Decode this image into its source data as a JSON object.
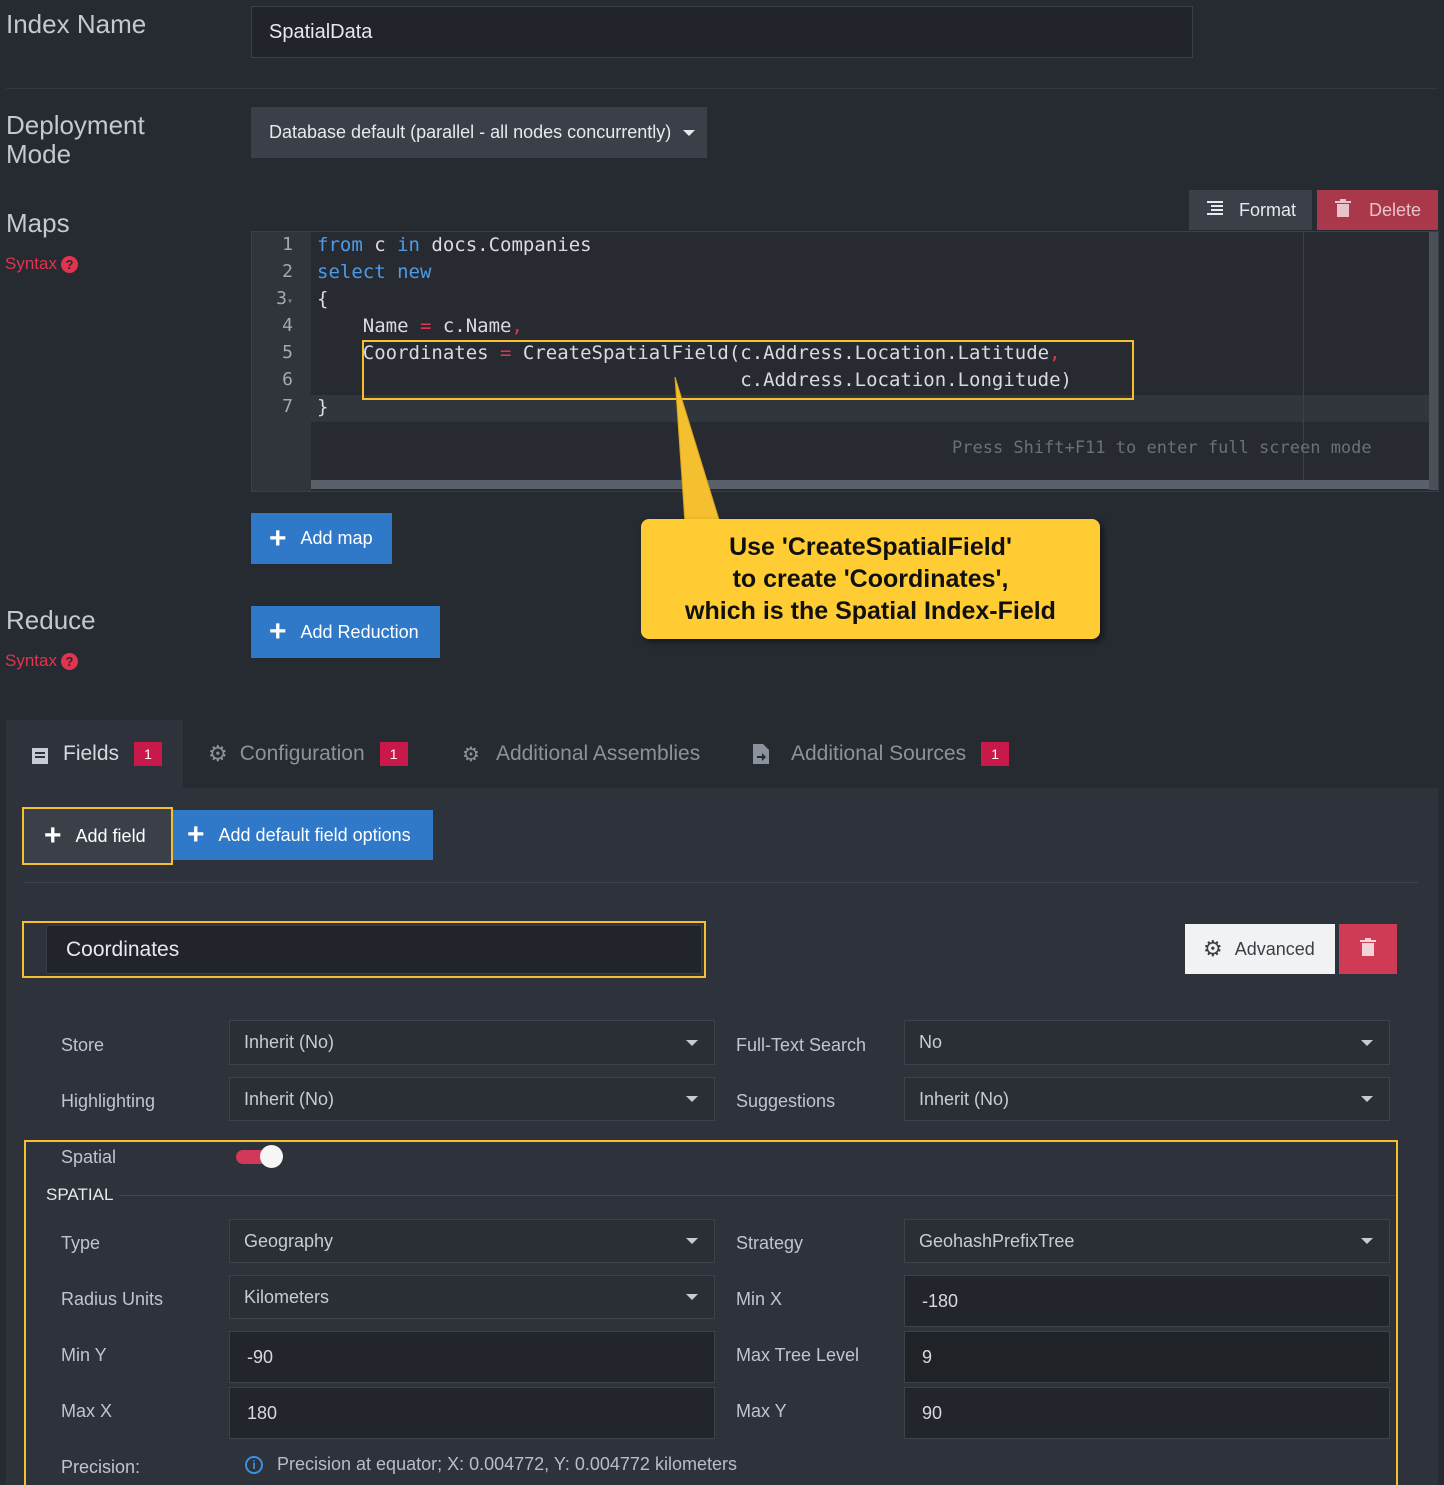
{
  "index_name": {
    "label": "Index Name",
    "value": "SpatialData"
  },
  "deployment": {
    "label": "Deployment Mode",
    "value": "Database default (parallel - all nodes concurrently)"
  },
  "maps": {
    "label": "Maps",
    "syntax_label": "Syntax",
    "format_label": "Format",
    "delete_label": "Delete",
    "add_map_label": "Add map",
    "code_lines": [
      {
        "num": "1",
        "text": "from c in docs.Companies"
      },
      {
        "num": "2",
        "text": "select new"
      },
      {
        "num": "3",
        "text": "{"
      },
      {
        "num": "4",
        "text": "    Name = c.Name,"
      },
      {
        "num": "5",
        "text": "    Coordinates = CreateSpatialField(c.Address.Location.Latitude,"
      },
      {
        "num": "6",
        "text": "                                     c.Address.Location.Longitude)"
      },
      {
        "num": "7",
        "text": "}"
      }
    ],
    "fullscreen_hint": "Press Shift+F11 to enter full screen mode"
  },
  "callout": {
    "line1": "Use 'CreateSpatialField'",
    "line2": "to create 'Coordinates',",
    "line3": "which is the Spatial Index-Field"
  },
  "reduce": {
    "label": "Reduce",
    "syntax_label": "Syntax",
    "add_reduction_label": "Add Reduction"
  },
  "tabs": [
    {
      "label": "Fields",
      "badge": "1"
    },
    {
      "label": "Configuration",
      "badge": "1"
    },
    {
      "label": "Additional Assemblies"
    },
    {
      "label": "Additional Sources",
      "badge": "1"
    }
  ],
  "fields_panel": {
    "add_field_label": "Add field",
    "add_default_label": "Add default field options",
    "field_name": "Coordinates",
    "advanced_label": "Advanced",
    "store": {
      "label": "Store",
      "value": "Inherit (No)"
    },
    "full_text": {
      "label": "Full-Text Search",
      "value": "No"
    },
    "highlighting": {
      "label": "Highlighting",
      "value": "Inherit (No)"
    },
    "suggestions": {
      "label": "Suggestions",
      "value": "Inherit (No)"
    },
    "spatial_toggle": {
      "label": "Spatial",
      "on": true
    },
    "spatial_section": "SPATIAL",
    "type": {
      "label": "Type",
      "value": "Geography"
    },
    "strategy": {
      "label": "Strategy",
      "value": "GeohashPrefixTree"
    },
    "radius_units": {
      "label": "Radius Units",
      "value": "Kilometers"
    },
    "min_x": {
      "label": "Min X",
      "value": "-180"
    },
    "min_y": {
      "label": "Min Y",
      "value": "-90"
    },
    "max_tree_level": {
      "label": "Max Tree Level",
      "value": "9"
    },
    "max_x": {
      "label": "Max X",
      "value": "180"
    },
    "max_y": {
      "label": "Max Y",
      "value": "90"
    },
    "precision": {
      "label": "Precision:",
      "value": "Precision at equator; X: 0.004772, Y: 0.004772 kilometers"
    }
  },
  "colors": {
    "accent": "#2f79c8",
    "danger": "#c8194a",
    "highlight": "#f5c02f"
  }
}
